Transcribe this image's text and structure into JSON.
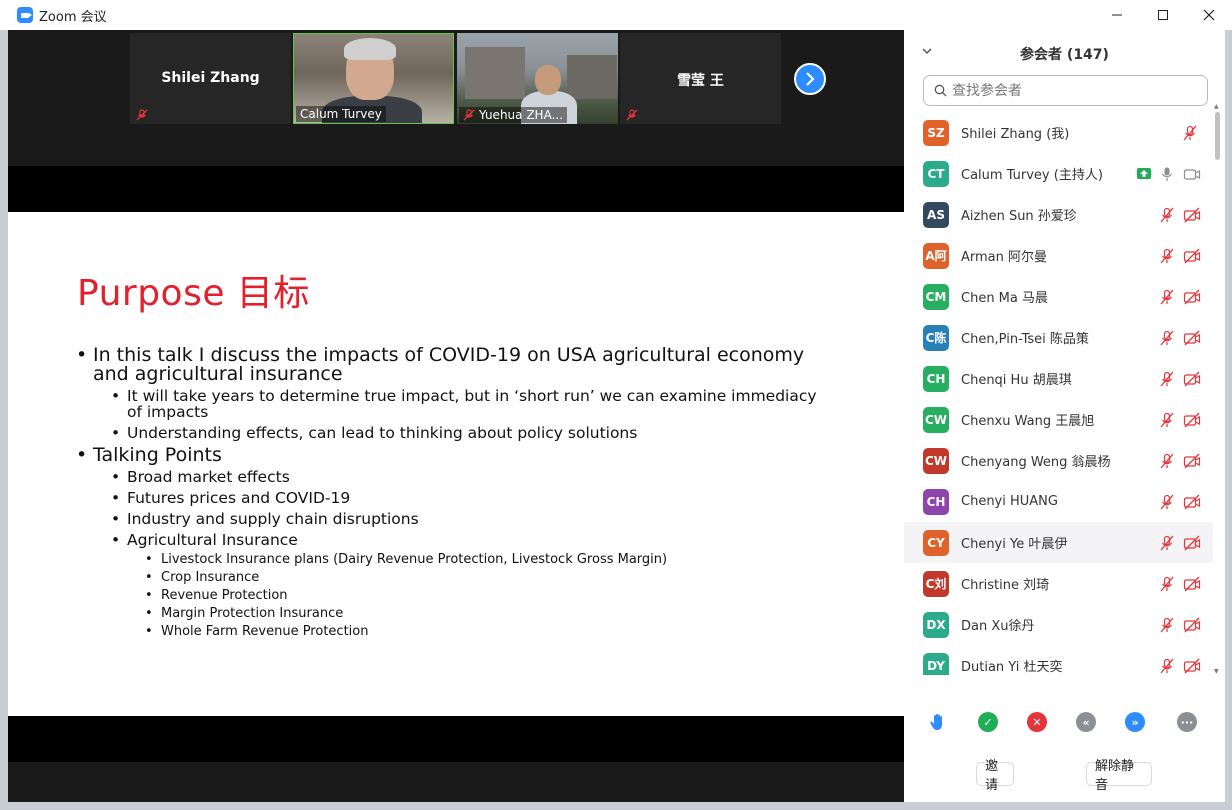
{
  "window": {
    "title": "Zoom 会议",
    "minimize": "─",
    "maximize": "☐",
    "close": "✕"
  },
  "gallery": {
    "tiles": [
      {
        "name": "Shilei Zhang",
        "muted": true,
        "video": false
      },
      {
        "name": "Calum Turvey",
        "muted": false,
        "video": true,
        "active": true
      },
      {
        "name": "Yuehua ZHA...",
        "muted": true,
        "video": true
      },
      {
        "name": "雪莹 王",
        "muted": true,
        "video": false
      }
    ],
    "next_icon": "chevron-right-icon"
  },
  "slide": {
    "title": "Purpose 目标",
    "bullets": [
      {
        "level": 1,
        "text": "In this talk I discuss the impacts of COVID-19 on USA agricultural economy and agricultural insurance"
      },
      {
        "level": 2,
        "text": "It will take years to determine true impact, but in ‘short run’ we can examine immediacy of impacts"
      },
      {
        "level": 2,
        "text": "Understanding effects, can lead to thinking about policy solutions"
      },
      {
        "level": 1,
        "text": "Talking Points"
      },
      {
        "level": 2,
        "text": "Broad market effects"
      },
      {
        "level": 2,
        "text": "Futures prices and COVID-19"
      },
      {
        "level": 2,
        "text": "Industry and supply chain disruptions"
      },
      {
        "level": 2,
        "text": "Agricultural Insurance"
      },
      {
        "level": 3,
        "text": "Livestock  Insurance plans (Dairy Revenue Protection, Livestock Gross Margin)"
      },
      {
        "level": 3,
        "text": "Crop Insurance"
      },
      {
        "level": 3,
        "text": "Revenue Protection"
      },
      {
        "level": 3,
        "text": "Margin Protection Insurance"
      },
      {
        "level": 3,
        "text": "Whole Farm Revenue Protection"
      }
    ]
  },
  "participants_panel": {
    "title": "参会者 (147)",
    "search_placeholder": "查找参会者",
    "list": [
      {
        "initials": "SZ",
        "color": "#e0612a",
        "name": "Shilei Zhang (我)",
        "mic": "muted",
        "video": "none"
      },
      {
        "initials": "CT",
        "color": "#2bab8c",
        "name": "Calum Turvey (主持人)",
        "mic": "on",
        "video": "on",
        "sharing": true
      },
      {
        "initials": "AS",
        "color": "#34495e",
        "name": "Aizhen Sun 孙爱珍",
        "mic": "muted",
        "video": "off"
      },
      {
        "initials": "A阿",
        "color": "#e0612a",
        "name": "Arman  阿尔曼",
        "mic": "muted",
        "video": "off"
      },
      {
        "initials": "CM",
        "color": "#27ae60",
        "name": "Chen Ma 马晨",
        "mic": "muted",
        "video": "off"
      },
      {
        "initials": "C陈",
        "color": "#2980b9",
        "name": "Chen,Pin-Tsei 陈品策",
        "mic": "muted",
        "video": "off"
      },
      {
        "initials": "CH",
        "color": "#27ae60",
        "name": "Chenqi Hu 胡晨琪",
        "mic": "muted",
        "video": "off"
      },
      {
        "initials": "CW",
        "color": "#27ae60",
        "name": "Chenxu Wang 王晨旭",
        "mic": "muted",
        "video": "off"
      },
      {
        "initials": "CW",
        "color": "#c0392b",
        "name": "Chenyang Weng 翁晨杨",
        "mic": "muted",
        "video": "off"
      },
      {
        "initials": "CH",
        "color": "#8e44ad",
        "name": "Chenyi HUANG",
        "mic": "muted",
        "video": "off"
      },
      {
        "initials": "CY",
        "color": "#e0612a",
        "name": "Chenyi Ye 叶晨伊",
        "mic": "muted",
        "video": "off",
        "highlight": true
      },
      {
        "initials": "C刘",
        "color": "#c0392b",
        "name": "Christine 刘琦",
        "mic": "muted",
        "video": "off"
      },
      {
        "initials": "DX",
        "color": "#2bab8c",
        "name": "Dan Xu徐丹",
        "mic": "muted",
        "video": "off"
      },
      {
        "initials": "DY",
        "color": "#2bab8c",
        "name": "Dutian Yi 杜天奕",
        "mic": "muted",
        "video": "off"
      }
    ],
    "reactions": [
      {
        "icon": "raise-hand-icon",
        "color": "#2d8cff"
      },
      {
        "icon": "yes-check-icon",
        "color": "#1fae55",
        "glyph": "✓"
      },
      {
        "icon": "no-x-icon",
        "color": "#e5343a",
        "glyph": "✕"
      },
      {
        "icon": "go-slower-icon",
        "color": "#8c8f94",
        "glyph": "«"
      },
      {
        "icon": "go-faster-icon",
        "color": "#2d8cff",
        "glyph": "»"
      },
      {
        "icon": "more-icon",
        "color": "#8c8f94",
        "glyph": "···"
      }
    ],
    "invite_label": "邀请",
    "unmute_label": "解除静音"
  },
  "colors": {
    "accent": "#2d8cff",
    "muted_red": "#e5343a",
    "slide_title": "#e3202c",
    "active_speaker": "#5ec84e"
  }
}
